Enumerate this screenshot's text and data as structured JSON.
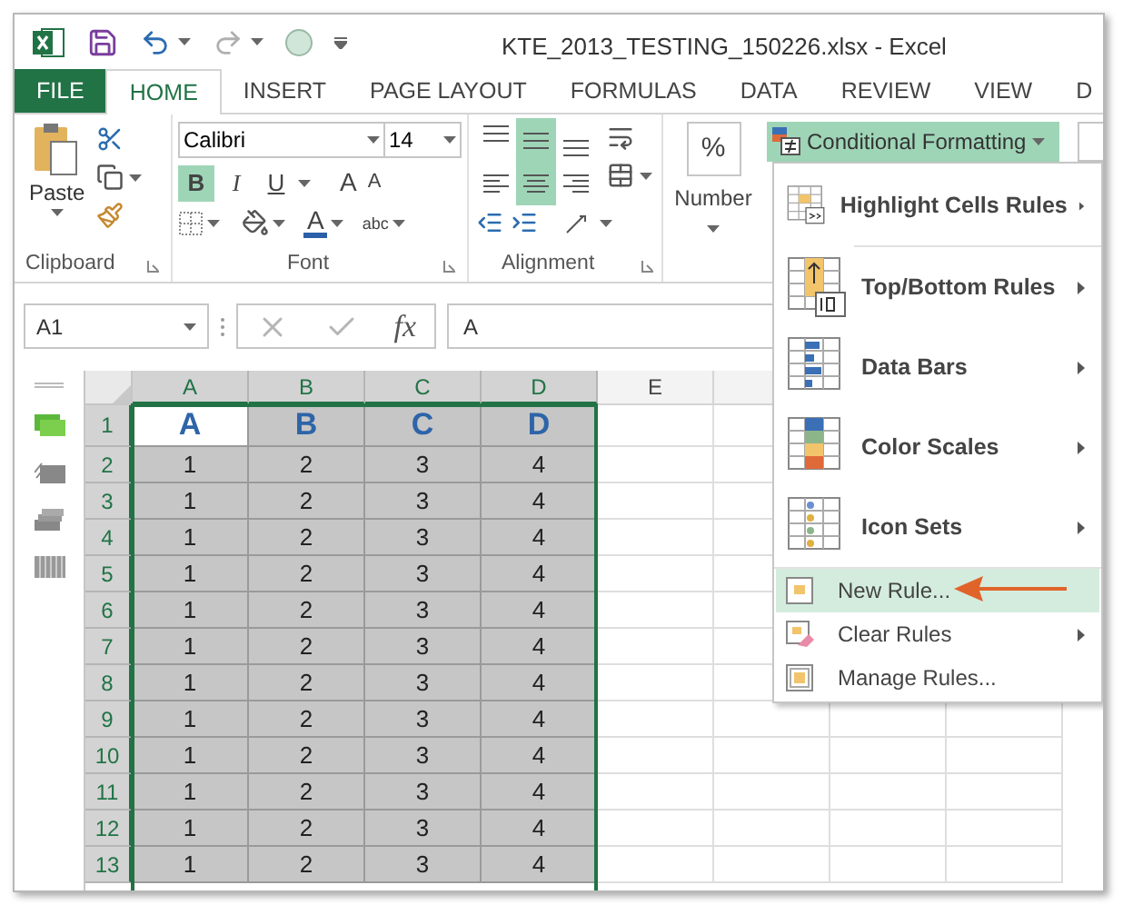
{
  "window": {
    "title": "KTE_2013_TESTING_150226.xlsx - Excel"
  },
  "quick_access": [
    {
      "kind": "save",
      "disabled": false
    },
    {
      "kind": "undo",
      "disabled": false
    },
    {
      "kind": "redo",
      "disabled": true
    },
    {
      "kind": "touch",
      "disabled": false
    }
  ],
  "tabs": [
    {
      "label": "FILE",
      "kind": "file",
      "selected": false
    },
    {
      "label": "HOME",
      "kind": "tab",
      "selected": true
    },
    {
      "label": "INSERT",
      "kind": "tab",
      "selected": false
    },
    {
      "label": "PAGE LAYOUT",
      "kind": "tab",
      "selected": false
    },
    {
      "label": "FORMULAS",
      "kind": "tab",
      "selected": false
    },
    {
      "label": "DATA",
      "kind": "tab",
      "selected": false
    },
    {
      "label": "REVIEW",
      "kind": "tab",
      "selected": false
    },
    {
      "label": "VIEW",
      "kind": "tab",
      "selected": false
    },
    {
      "label": "D",
      "kind": "tab",
      "selected": false
    }
  ],
  "ribbon": {
    "clipboard": {
      "label": "Clipboard",
      "paste": "Paste"
    },
    "font": {
      "label": "Font",
      "font_name": "Calibri",
      "font_size": "14",
      "styles": [
        {
          "label": "B",
          "selected": true
        },
        {
          "label": "I",
          "selected": false
        },
        {
          "label": "U",
          "selected": false
        }
      ],
      "grow": "A",
      "shrink": "A",
      "font_color": "A",
      "orientation_text": "abc"
    },
    "alignment": {
      "label": "Alignment",
      "buttons": [
        {
          "kind": "top",
          "selected": false
        },
        {
          "kind": "middle",
          "selected": true
        },
        {
          "kind": "bottom",
          "selected": false
        },
        {
          "kind": "left",
          "selected": false
        },
        {
          "kind": "center",
          "selected": true
        },
        {
          "kind": "right",
          "selected": false
        }
      ]
    },
    "number": {
      "symbol": "%",
      "label": "Number"
    },
    "conditional_formatting": {
      "label": "Conditional Formatting",
      "expanded": true
    }
  },
  "formula_bar": {
    "name_box": "A1",
    "function_label": "fx",
    "formula": "A"
  },
  "sheet": {
    "columns": [
      {
        "label": "A",
        "selected": true
      },
      {
        "label": "B",
        "selected": true
      },
      {
        "label": "C",
        "selected": true
      },
      {
        "label": "D",
        "selected": true
      },
      {
        "label": "E",
        "selected": false
      }
    ],
    "rows": [
      {
        "label": "1",
        "kind": "header",
        "cells": [
          {
            "value": "A",
            "active": true
          },
          {
            "value": "B",
            "active": false
          },
          {
            "value": "C",
            "active": false
          },
          {
            "value": "D",
            "active": false
          }
        ]
      },
      {
        "label": "2",
        "kind": "data",
        "cells": [
          {
            "value": "1",
            "active": false
          },
          {
            "value": "2",
            "active": false
          },
          {
            "value": "3",
            "active": false
          },
          {
            "value": "4",
            "active": false
          }
        ]
      },
      {
        "label": "3",
        "kind": "data",
        "cells": [
          {
            "value": "1",
            "active": false
          },
          {
            "value": "2",
            "active": false
          },
          {
            "value": "3",
            "active": false
          },
          {
            "value": "4",
            "active": false
          }
        ]
      },
      {
        "label": "4",
        "kind": "data",
        "cells": [
          {
            "value": "1",
            "active": false
          },
          {
            "value": "2",
            "active": false
          },
          {
            "value": "3",
            "active": false
          },
          {
            "value": "4",
            "active": false
          }
        ]
      },
      {
        "label": "5",
        "kind": "data",
        "cells": [
          {
            "value": "1",
            "active": false
          },
          {
            "value": "2",
            "active": false
          },
          {
            "value": "3",
            "active": false
          },
          {
            "value": "4",
            "active": false
          }
        ]
      },
      {
        "label": "6",
        "kind": "data",
        "cells": [
          {
            "value": "1",
            "active": false
          },
          {
            "value": "2",
            "active": false
          },
          {
            "value": "3",
            "active": false
          },
          {
            "value": "4",
            "active": false
          }
        ]
      },
      {
        "label": "7",
        "kind": "data",
        "cells": [
          {
            "value": "1",
            "active": false
          },
          {
            "value": "2",
            "active": false
          },
          {
            "value": "3",
            "active": false
          },
          {
            "value": "4",
            "active": false
          }
        ]
      },
      {
        "label": "8",
        "kind": "data",
        "cells": [
          {
            "value": "1",
            "active": false
          },
          {
            "value": "2",
            "active": false
          },
          {
            "value": "3",
            "active": false
          },
          {
            "value": "4",
            "active": false
          }
        ]
      },
      {
        "label": "9",
        "kind": "data",
        "cells": [
          {
            "value": "1",
            "active": false
          },
          {
            "value": "2",
            "active": false
          },
          {
            "value": "3",
            "active": false
          },
          {
            "value": "4",
            "active": false
          }
        ]
      },
      {
        "label": "10",
        "kind": "data",
        "cells": [
          {
            "value": "1",
            "active": false
          },
          {
            "value": "2",
            "active": false
          },
          {
            "value": "3",
            "active": false
          },
          {
            "value": "4",
            "active": false
          }
        ]
      },
      {
        "label": "11",
        "kind": "data",
        "cells": [
          {
            "value": "1",
            "active": false
          },
          {
            "value": "2",
            "active": false
          },
          {
            "value": "3",
            "active": false
          },
          {
            "value": "4",
            "active": false
          }
        ]
      },
      {
        "label": "12",
        "kind": "data",
        "cells": [
          {
            "value": "1",
            "active": false
          },
          {
            "value": "2",
            "active": false
          },
          {
            "value": "3",
            "active": false
          },
          {
            "value": "4",
            "active": false
          }
        ]
      },
      {
        "label": "13",
        "kind": "data",
        "cells": [
          {
            "value": "1",
            "active": false
          },
          {
            "value": "2",
            "active": false
          },
          {
            "value": "3",
            "active": false
          },
          {
            "value": "4",
            "active": false
          }
        ]
      }
    ]
  },
  "menu": {
    "items": [
      {
        "label": "Highlight Cells Rules",
        "kind": "large",
        "submenu": true,
        "selected": false
      },
      {
        "label": "Top/Bottom Rules",
        "kind": "large",
        "submenu": true,
        "selected": false
      },
      {
        "label": "Data Bars",
        "kind": "large",
        "submenu": true,
        "selected": false
      },
      {
        "label": "Color Scales",
        "kind": "large",
        "submenu": true,
        "selected": false
      },
      {
        "label": "Icon Sets",
        "kind": "large",
        "submenu": true,
        "selected": false
      },
      {
        "label": "New Rule...",
        "kind": "small",
        "submenu": false,
        "selected": true
      },
      {
        "label": "Clear Rules",
        "kind": "small",
        "submenu": true,
        "selected": false
      },
      {
        "label": "Manage Rules...",
        "kind": "small",
        "submenu": false,
        "selected": false
      }
    ]
  }
}
